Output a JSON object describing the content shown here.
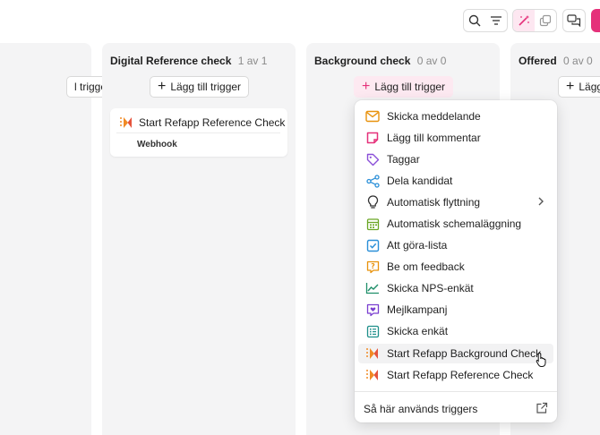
{
  "colors": {
    "accent_pink": "#e5317a",
    "column_bg": "#f4f4f5"
  },
  "toolbar": {
    "icons": [
      "search-icon",
      "filter-icon",
      "magic-wand-icon",
      "copy-icon",
      "chat-icon"
    ]
  },
  "columns": [
    {
      "title": "",
      "count": "",
      "add_label": "l trigger"
    },
    {
      "title": "Digital Reference check",
      "count": "1 av 1",
      "add_label": "Lägg till trigger",
      "card": {
        "title": "Start Refapp Reference Check",
        "subtitle": "Webhook"
      }
    },
    {
      "title": "Background check",
      "count": "0 av 0",
      "add_label": "Lägg till trigger"
    },
    {
      "title": "Offered",
      "count": "0 av 0",
      "add_label": "Lägg"
    }
  ],
  "menu": {
    "items": [
      {
        "label": "Skicka meddelande",
        "icon": "envelope-icon"
      },
      {
        "label": "Lägg till kommentar",
        "icon": "comment-icon"
      },
      {
        "label": "Taggar",
        "icon": "tag-icon"
      },
      {
        "label": "Dela kandidat",
        "icon": "share-icon"
      },
      {
        "label": "Automatisk flyttning",
        "icon": "lightbulb-icon",
        "submenu": true
      },
      {
        "label": "Automatisk schemaläggning",
        "icon": "calendar-icon"
      },
      {
        "label": "Att göra-lista",
        "icon": "checkbox-icon"
      },
      {
        "label": "Be om feedback",
        "icon": "question-icon"
      },
      {
        "label": "Skicka NPS-enkät",
        "icon": "chart-line-icon"
      },
      {
        "label": "Mejlkampanj",
        "icon": "heart-message-icon"
      },
      {
        "label": "Skicka enkät",
        "icon": "list-icon"
      },
      {
        "label": "Start Refapp Background Check",
        "icon": "refapp-icon"
      },
      {
        "label": "Start Refapp Reference Check",
        "icon": "refapp-icon"
      }
    ],
    "footer": "Så här används triggers"
  }
}
